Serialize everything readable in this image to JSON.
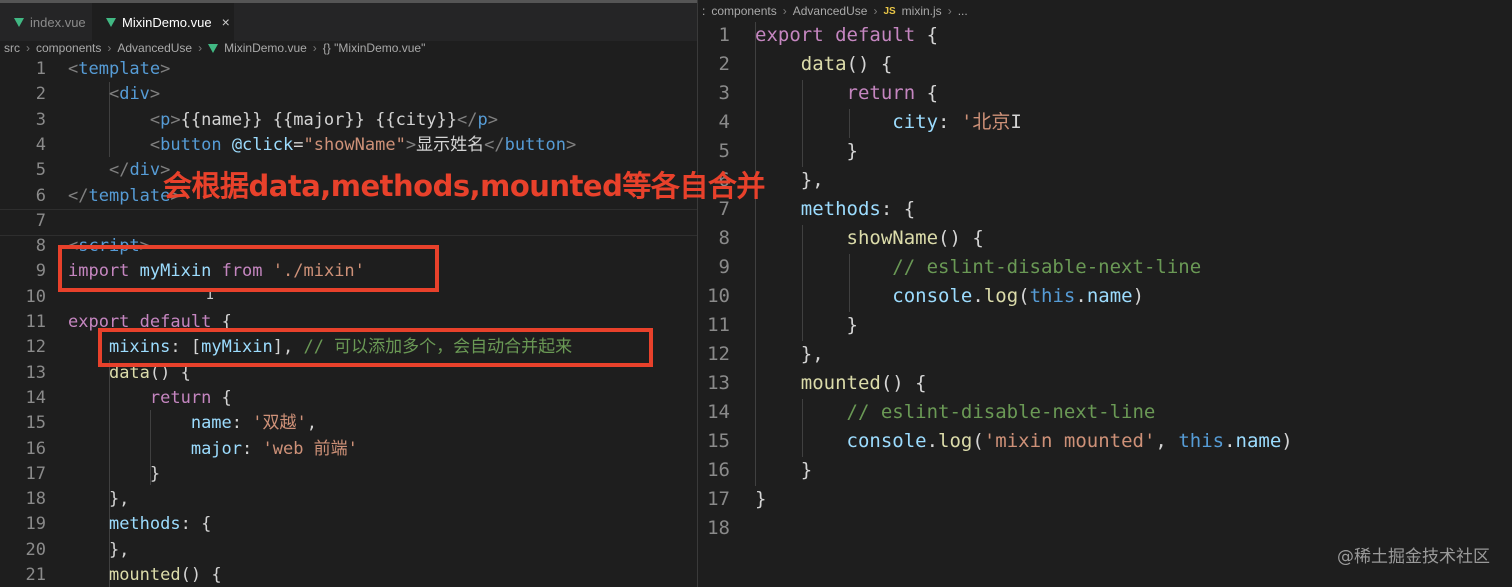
{
  "left_editor": {
    "tabs": [
      {
        "label": "index.vue",
        "active": false
      },
      {
        "label": "MixinDemo.vue",
        "active": true,
        "close": "×"
      }
    ],
    "breadcrumb": [
      "src",
      "components",
      "AdvancedUse",
      "MixinDemo.vue",
      "{} \"MixinDemo.vue\""
    ],
    "lines": [
      {
        "n": "1",
        "tokens": [
          [
            "ang",
            "<"
          ],
          [
            "tag",
            "template"
          ],
          [
            "ang",
            ">"
          ]
        ]
      },
      {
        "n": "2",
        "tokens": [
          [
            "t",
            "    "
          ],
          [
            "ang",
            "<"
          ],
          [
            "tag",
            "div"
          ],
          [
            "ang",
            ">"
          ]
        ]
      },
      {
        "n": "3",
        "tokens": [
          [
            "t",
            "        "
          ],
          [
            "ang",
            "<"
          ],
          [
            "tag",
            "p"
          ],
          [
            "ang",
            ">"
          ],
          [
            "t",
            "{{name}} {{major}} {{city}}"
          ],
          [
            "ang",
            "</"
          ],
          [
            "tag",
            "p"
          ],
          [
            "ang",
            ">"
          ]
        ]
      },
      {
        "n": "4",
        "tokens": [
          [
            "t",
            "        "
          ],
          [
            "ang",
            "<"
          ],
          [
            "tag",
            "button"
          ],
          [
            "t",
            " "
          ],
          [
            "prop",
            "@click"
          ],
          [
            "t",
            "="
          ],
          [
            "str",
            "\"showName\""
          ],
          [
            "ang",
            ">"
          ],
          [
            "t",
            "显示姓名"
          ],
          [
            "ang",
            "</"
          ],
          [
            "tag",
            "button"
          ],
          [
            "ang",
            ">"
          ]
        ]
      },
      {
        "n": "5",
        "tokens": [
          [
            "t",
            "    "
          ],
          [
            "ang",
            "</"
          ],
          [
            "tag",
            "div"
          ],
          [
            "ang",
            ">"
          ]
        ]
      },
      {
        "n": "6",
        "tokens": [
          [
            "ang",
            "</"
          ],
          [
            "tag",
            "template"
          ],
          [
            "ang",
            ">"
          ]
        ]
      },
      {
        "n": "7",
        "tokens": []
      },
      {
        "n": "8",
        "tokens": [
          [
            "ang",
            "<"
          ],
          [
            "tag",
            "script"
          ],
          [
            "ang",
            ">"
          ]
        ]
      },
      {
        "n": "9",
        "tokens": [
          [
            "kw",
            "import"
          ],
          [
            "t",
            " "
          ],
          [
            "var",
            "myMixin"
          ],
          [
            "t",
            " "
          ],
          [
            "kw",
            "from"
          ],
          [
            "t",
            " "
          ],
          [
            "str",
            "'./mixin'"
          ]
        ]
      },
      {
        "n": "10",
        "tokens": []
      },
      {
        "n": "11",
        "tokens": [
          [
            "kw",
            "export"
          ],
          [
            "t",
            " "
          ],
          [
            "kw",
            "default"
          ],
          [
            "t",
            " {"
          ]
        ]
      },
      {
        "n": "12",
        "tokens": [
          [
            "t",
            "    "
          ],
          [
            "prop",
            "mixins"
          ],
          [
            "t",
            ": ["
          ],
          [
            "var",
            "myMixin"
          ],
          [
            "t",
            "], "
          ],
          [
            "cmt",
            "// 可以添加多个，会自动合并起来"
          ]
        ]
      },
      {
        "n": "13",
        "tokens": [
          [
            "t",
            "    "
          ],
          [
            "fn",
            "data"
          ],
          [
            "t",
            "() {"
          ]
        ]
      },
      {
        "n": "14",
        "tokens": [
          [
            "t",
            "        "
          ],
          [
            "ctl",
            "return"
          ],
          [
            "t",
            " {"
          ]
        ]
      },
      {
        "n": "15",
        "tokens": [
          [
            "t",
            "            "
          ],
          [
            "prop",
            "name"
          ],
          [
            "t",
            ": "
          ],
          [
            "str",
            "'双越'"
          ],
          [
            "t",
            ","
          ]
        ]
      },
      {
        "n": "16",
        "tokens": [
          [
            "t",
            "            "
          ],
          [
            "prop",
            "major"
          ],
          [
            "t",
            ": "
          ],
          [
            "str",
            "'web 前端'"
          ]
        ]
      },
      {
        "n": "17",
        "tokens": [
          [
            "t",
            "        }"
          ]
        ]
      },
      {
        "n": "18",
        "tokens": [
          [
            "t",
            "    },"
          ]
        ]
      },
      {
        "n": "19",
        "tokens": [
          [
            "t",
            "    "
          ],
          [
            "prop",
            "methods"
          ],
          [
            "t",
            ": {"
          ]
        ]
      },
      {
        "n": "20",
        "tokens": [
          [
            "t",
            "    },"
          ]
        ]
      },
      {
        "n": "21",
        "tokens": [
          [
            "t",
            "    "
          ],
          [
            "fn",
            "mounted"
          ],
          [
            "t",
            "() {"
          ]
        ]
      }
    ]
  },
  "right_editor": {
    "breadcrumb": [
      ":",
      "components",
      "AdvancedUse",
      "JS",
      "mixin.js",
      "..."
    ],
    "lines": [
      {
        "n": "1",
        "tokens": [
          [
            "kw",
            "export"
          ],
          [
            "t",
            " "
          ],
          [
            "kw",
            "default"
          ],
          [
            "t",
            " {"
          ]
        ]
      },
      {
        "n": "2",
        "tokens": [
          [
            "t",
            "    "
          ],
          [
            "fn",
            "data"
          ],
          [
            "t",
            "() {"
          ]
        ]
      },
      {
        "n": "3",
        "tokens": [
          [
            "t",
            "        "
          ],
          [
            "ctl",
            "return"
          ],
          [
            "t",
            " {"
          ]
        ]
      },
      {
        "n": "4",
        "tokens": [
          [
            "t",
            "            "
          ],
          [
            "prop",
            "city"
          ],
          [
            "t",
            ": "
          ],
          [
            "str",
            "'北京"
          ],
          [
            "t",
            "I"
          ]
        ]
      },
      {
        "n": "5",
        "tokens": [
          [
            "t",
            "        }"
          ]
        ]
      },
      {
        "n": "6",
        "tokens": [
          [
            "t",
            "    },"
          ]
        ]
      },
      {
        "n": "7",
        "tokens": [
          [
            "t",
            "    "
          ],
          [
            "prop",
            "methods"
          ],
          [
            "t",
            ": {"
          ]
        ]
      },
      {
        "n": "8",
        "tokens": [
          [
            "t",
            "        "
          ],
          [
            "fn",
            "showName"
          ],
          [
            "t",
            "() {"
          ]
        ]
      },
      {
        "n": "9",
        "tokens": [
          [
            "t",
            "            "
          ],
          [
            "cmt",
            "// eslint-disable-next-line"
          ]
        ]
      },
      {
        "n": "10",
        "tokens": [
          [
            "t",
            "            "
          ],
          [
            "var",
            "console"
          ],
          [
            "t",
            "."
          ],
          [
            "fn",
            "log"
          ],
          [
            "t",
            "("
          ],
          [
            "this",
            "this"
          ],
          [
            "t",
            "."
          ],
          [
            "prop",
            "name"
          ],
          [
            "t",
            ")"
          ]
        ]
      },
      {
        "n": "11",
        "tokens": [
          [
            "t",
            "        }"
          ]
        ]
      },
      {
        "n": "12",
        "tokens": [
          [
            "t",
            "    },"
          ]
        ]
      },
      {
        "n": "13",
        "tokens": [
          [
            "t",
            "    "
          ],
          [
            "fn",
            "mounted"
          ],
          [
            "t",
            "() {"
          ]
        ]
      },
      {
        "n": "14",
        "tokens": [
          [
            "t",
            "        "
          ],
          [
            "cmt",
            "// eslint-disable-next-line"
          ]
        ]
      },
      {
        "n": "15",
        "tokens": [
          [
            "t",
            "        "
          ],
          [
            "var",
            "console"
          ],
          [
            "t",
            "."
          ],
          [
            "fn",
            "log"
          ],
          [
            "t",
            "("
          ],
          [
            "str",
            "'mixin mounted'"
          ],
          [
            "t",
            ", "
          ],
          [
            "this",
            "this"
          ],
          [
            "t",
            "."
          ],
          [
            "prop",
            "name"
          ],
          [
            "t",
            ")"
          ]
        ]
      },
      {
        "n": "16",
        "tokens": [
          [
            "t",
            "    }"
          ]
        ]
      },
      {
        "n": "17",
        "tokens": [
          [
            "t",
            "}"
          ]
        ]
      },
      {
        "n": "18",
        "tokens": []
      }
    ]
  },
  "annotation": {
    "text": "会根据data,methods,mounted等各自合并",
    "color": "#e8412b"
  },
  "watermark": "@稀土掘金技术社区"
}
